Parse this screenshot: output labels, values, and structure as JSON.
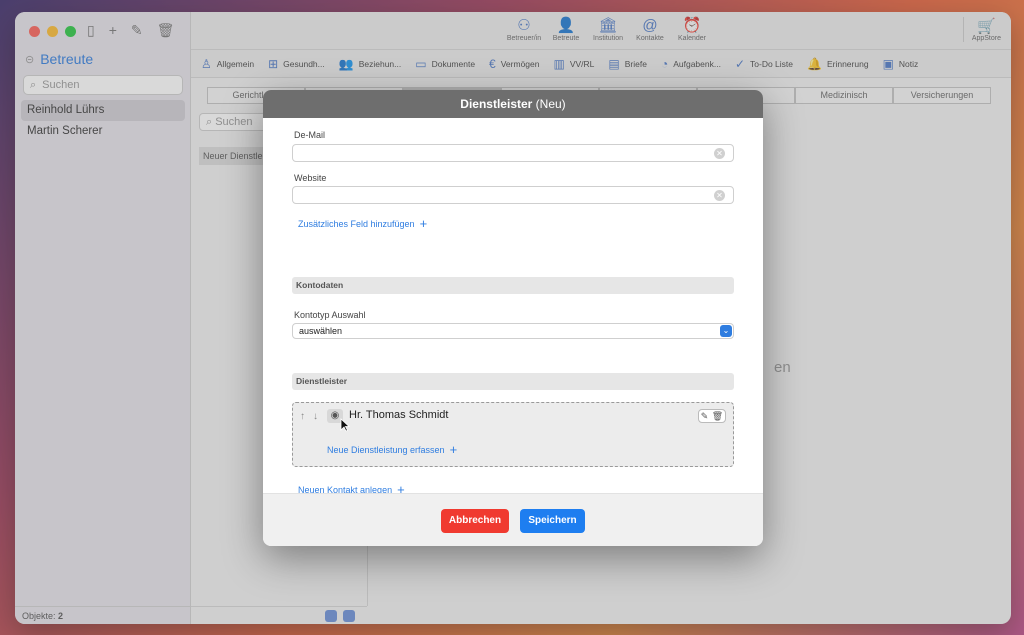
{
  "sidebar": {
    "title": "Betreute",
    "search_placeholder": "Suchen",
    "items": [
      {
        "label": "Reinhold Lührs"
      },
      {
        "label": "Martin Scherer"
      }
    ],
    "footer_label": "Objekte:",
    "footer_count": "2"
  },
  "toolbar": {
    "buttons": [
      {
        "label": "Betreuer/in",
        "icon": "person-group-icon"
      },
      {
        "label": "Betreute",
        "icon": "person-icon"
      },
      {
        "label": "Institution",
        "icon": "building-icon"
      },
      {
        "label": "Kontakte",
        "icon": "at-icon"
      },
      {
        "label": "Kalender",
        "icon": "alarm-icon"
      }
    ],
    "store_label": "AppStore"
  },
  "tabs": [
    {
      "label": "Allgemein",
      "icon": "person-icon"
    },
    {
      "label": "Gesundh...",
      "icon": "medkit-icon"
    },
    {
      "label": "Beziehun...",
      "icon": "people-icon"
    },
    {
      "label": "Dokumente",
      "icon": "folder-icon"
    },
    {
      "label": "Vermögen",
      "icon": "euro-icon"
    },
    {
      "label": "VV/RL",
      "icon": "book-icon"
    },
    {
      "label": "Briefe",
      "icon": "doc-icon"
    },
    {
      "label": "Aufgabenk...",
      "icon": "task-icon"
    },
    {
      "label": "To-Do Liste",
      "icon": "check-icon"
    },
    {
      "label": "Erinnerung",
      "icon": "bell-icon"
    },
    {
      "label": "Notiz",
      "icon": "note-icon"
    }
  ],
  "subtabs": [
    {
      "label": "Gerichtl. Be"
    },
    {
      "label": ""
    },
    {
      "label": ""
    },
    {
      "label": ""
    },
    {
      "label": ""
    },
    {
      "label": ""
    },
    {
      "label": "Medizinisch"
    },
    {
      "label": "Versicherungen"
    }
  ],
  "main": {
    "search_placeholder": "Suchen",
    "list_item": "Neuer Dienstle",
    "ghost_text": "en"
  },
  "modal": {
    "title_bold": "Dienstleister",
    "title_suffix": "(Neu)",
    "demail_label": "De-Mail",
    "demail_value": "",
    "website_label": "Website",
    "website_value": "",
    "add_field_link": "Zusätzliches Feld hinzufügen",
    "kontodaten_header": "Kontodaten",
    "kontotyp_label": "Kontotyp Auswahl",
    "kontotyp_value": "auswählen",
    "dienstleister_header": "Dienstleister",
    "provider_name": "Hr. Thomas Schmidt",
    "new_service_link": "Neue Dienstleistung erfassen",
    "new_contact_link": "Neuen Kontakt anlegen",
    "cancel_label": "Abbrechen",
    "save_label": "Speichern"
  },
  "colors": {
    "accent": "#2f7de0",
    "cancel": "#f03a30",
    "save": "#1e7ef0",
    "modal_header": "#6e6e6e"
  }
}
